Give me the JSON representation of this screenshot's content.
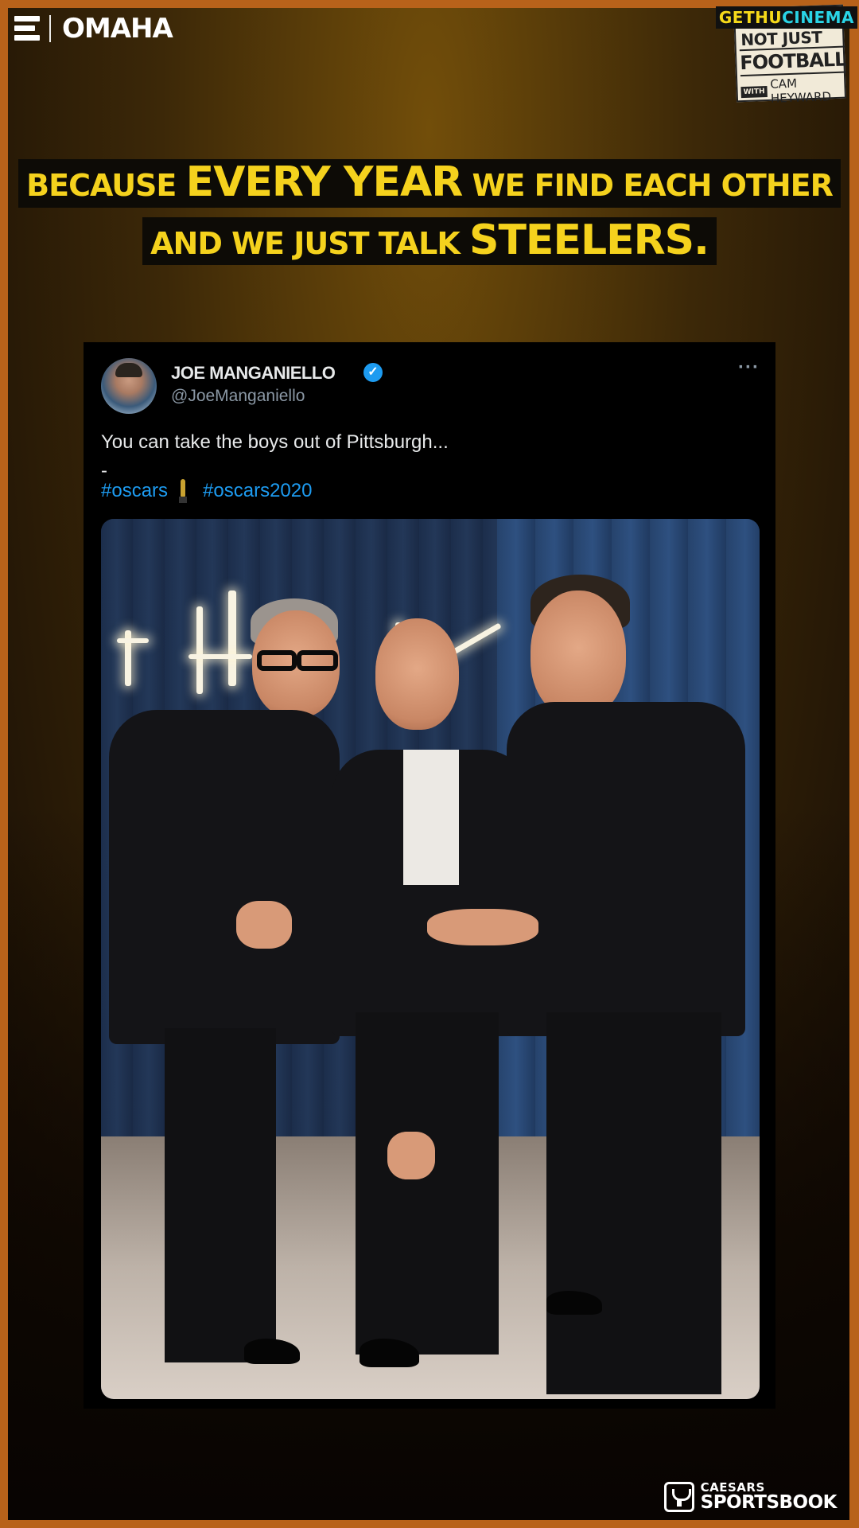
{
  "brand": {
    "network_icon": "espn-e-logo",
    "network_name": "OMAHA"
  },
  "show_badge": {
    "watermark_part1": "GETHU",
    "watermark_part2": "CINEMA",
    "line1": "NOT JUST",
    "line2": "FOOTBALL",
    "with": "WITH",
    "host": "CAM HEYWARD"
  },
  "headline": {
    "line1": [
      {
        "text": "BECAUSE ",
        "size": "sm"
      },
      {
        "text": "EVERY YEAR",
        "size": "lg"
      },
      {
        "text": " WE FIND EACH OTHER",
        "size": "sm"
      }
    ],
    "line2": [
      {
        "text": "AND WE JUST TALK ",
        "size": "sm"
      },
      {
        "text": "STEELERS.",
        "size": "lg"
      }
    ]
  },
  "tweet": {
    "author_name": "JOE MANGANIELLO",
    "verified_icon": "verified-badge-icon",
    "handle": "@JoeManganiello",
    "more_label": "···",
    "text": "You can take the boys out of Pittsburgh...",
    "separator": "-",
    "hashtag1": "#oscars",
    "hashtag_icon": "oscar-statuette-icon",
    "hashtag2": "#oscars2020",
    "photo_alt": "Three men in black tuxedos posing in front of a neon sign"
  },
  "sponsor": {
    "icon": "trophy-cup-icon",
    "line1": "CAESARS",
    "line2": "SPORTSBOOK"
  },
  "colors": {
    "headline_yellow": "#f5d21d",
    "link_blue": "#1d9bf0",
    "border_orange": "#b8621a"
  }
}
